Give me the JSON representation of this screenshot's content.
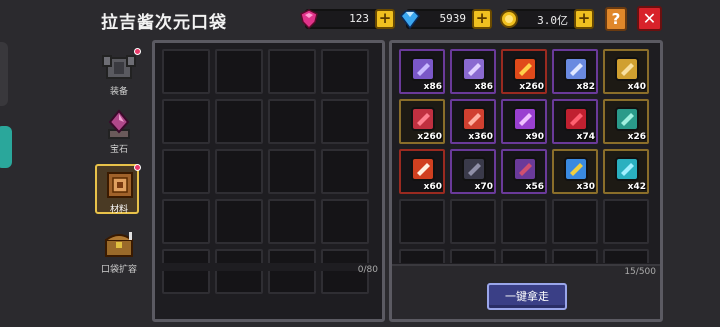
{
  "header": {
    "title": "拉吉酱次元口袋",
    "resources": [
      {
        "name": "pink-gem",
        "value": "123",
        "color": "#e0338a"
      },
      {
        "name": "blue-gem",
        "value": "5939",
        "color": "#3aa6f0"
      },
      {
        "name": "gold-coin",
        "value": "3.0亿",
        "color": "#f0c020"
      }
    ],
    "plus_label": "+",
    "help_label": "?",
    "close_label": "✕"
  },
  "tabs": [
    {
      "label": "装备",
      "icon": "armor-icon",
      "badge": true
    },
    {
      "label": "宝石",
      "icon": "gem-icon",
      "badge": false
    },
    {
      "label": "材料",
      "icon": "material-book-icon",
      "badge": true,
      "active": true
    },
    {
      "label": "口袋扩容",
      "icon": "chest-icon",
      "badge": false
    }
  ],
  "pocket": {
    "capacity": "0/80"
  },
  "storage": {
    "capacity": "15/500",
    "take_all_label": "一键拿走",
    "items": [
      {
        "icon": "purple-blade-icon",
        "qty": "x86",
        "rarity": "epic"
      },
      {
        "icon": "purple-staff-icon",
        "qty": "x86",
        "rarity": "epic"
      },
      {
        "icon": "fire-crystal-icon",
        "qty": "x260",
        "rarity": "leg"
      },
      {
        "icon": "spear-tip-icon",
        "qty": "x82",
        "rarity": "epic"
      },
      {
        "icon": "gold-hammer-icon",
        "qty": "x40",
        "rarity": "rare"
      },
      {
        "icon": "red-crystal-icon",
        "qty": "x260",
        "rarity": "rare"
      },
      {
        "icon": "red-rune-icon",
        "qty": "x360",
        "rarity": "epic"
      },
      {
        "icon": "purple-orb-icon",
        "qty": "x90",
        "rarity": "epic"
      },
      {
        "icon": "red-scroll-icon",
        "qty": "x74",
        "rarity": "epic"
      },
      {
        "icon": "teal-fish-icon",
        "qty": "x26",
        "rarity": "rare"
      },
      {
        "icon": "lava-ore-icon",
        "qty": "x60",
        "rarity": "leg"
      },
      {
        "icon": "dark-staff-icon",
        "qty": "x70",
        "rarity": "epic"
      },
      {
        "icon": "purple-shield-icon",
        "qty": "x56",
        "rarity": "epic"
      },
      {
        "icon": "blue-monster-icon",
        "qty": "x30",
        "rarity": "rare"
      },
      {
        "icon": "cyan-key-icon",
        "qty": "x42",
        "rarity": "rare"
      }
    ]
  }
}
